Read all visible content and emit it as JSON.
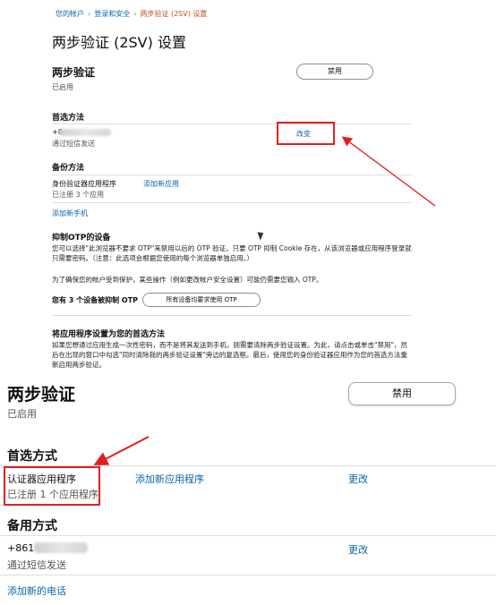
{
  "top": {
    "breadcrumb": {
      "account": "您的帐户",
      "login_security": "登录和安全",
      "current": "两步验证 (2SV) 设置"
    },
    "page_title": "两步验证 (2SV) 设置",
    "two_step": {
      "heading": "两步验证",
      "status": "已启用",
      "disable_label": "禁用"
    },
    "preferred": {
      "heading": "首选方法",
      "phone_prefix": "+8",
      "via": "通过短信发送",
      "change_label": "改变"
    },
    "backup": {
      "heading": "备份方法",
      "app_name": "身份验证器应用程序",
      "registered": "已注册 3 个应用",
      "add_app": "添加新应用",
      "add_phone": "添加新手机"
    },
    "otp": {
      "heading": "抑制OTP的设备",
      "desc1": "您可以选择\"此浏览器不要求 OTP\"来禁用以后的 OTP 验证。只要 OTP 抑制 Cookie 存在，从该浏览器或应用程序登录就只需要密码。（注意：此选项会根据您使用的每个浏览器单独启用。）",
      "desc2": "为了确保您的帐户受到保护，某些操作（例如更改帐户安全设置）可能仍需要您输入 OTP。",
      "count_text": "您有 3 个设备被抑制 OTP",
      "require_all_label": "所有设备均要求使用 OTP"
    },
    "app_pref": {
      "heading": "将应用程序设置为您的首选方法",
      "desc": "如果您想通过应用生成一次性密码，而不是将其发送到手机，则需要清除两步验证设置。为此，请点击或单击\"禁用\"，然后在出现的窗口中勾选\"同时清除我的两步验证设置\"旁边的复选框。最后，使用您的身份验证器应用作为您的首选方法重新启用两步验证。"
    }
  },
  "bottom": {
    "two_step": {
      "heading": "两步验证",
      "status": "已启用",
      "disable_label": "禁用"
    },
    "preferred": {
      "heading": "首选方式",
      "app_name": "认证器应用程序",
      "registered": "已注册 1 个应用程序",
      "add_app": "添加新应用程序",
      "change_label": "更改"
    },
    "backup": {
      "heading": "备用方式",
      "phone_prefix": "+861",
      "via": "通过短信发送",
      "change_label": "更改",
      "add_phone": "添加新的电话"
    }
  },
  "colors": {
    "link": "#0a66a8",
    "highlight": "#e02020",
    "breadcrumb_current": "#c7511f"
  }
}
